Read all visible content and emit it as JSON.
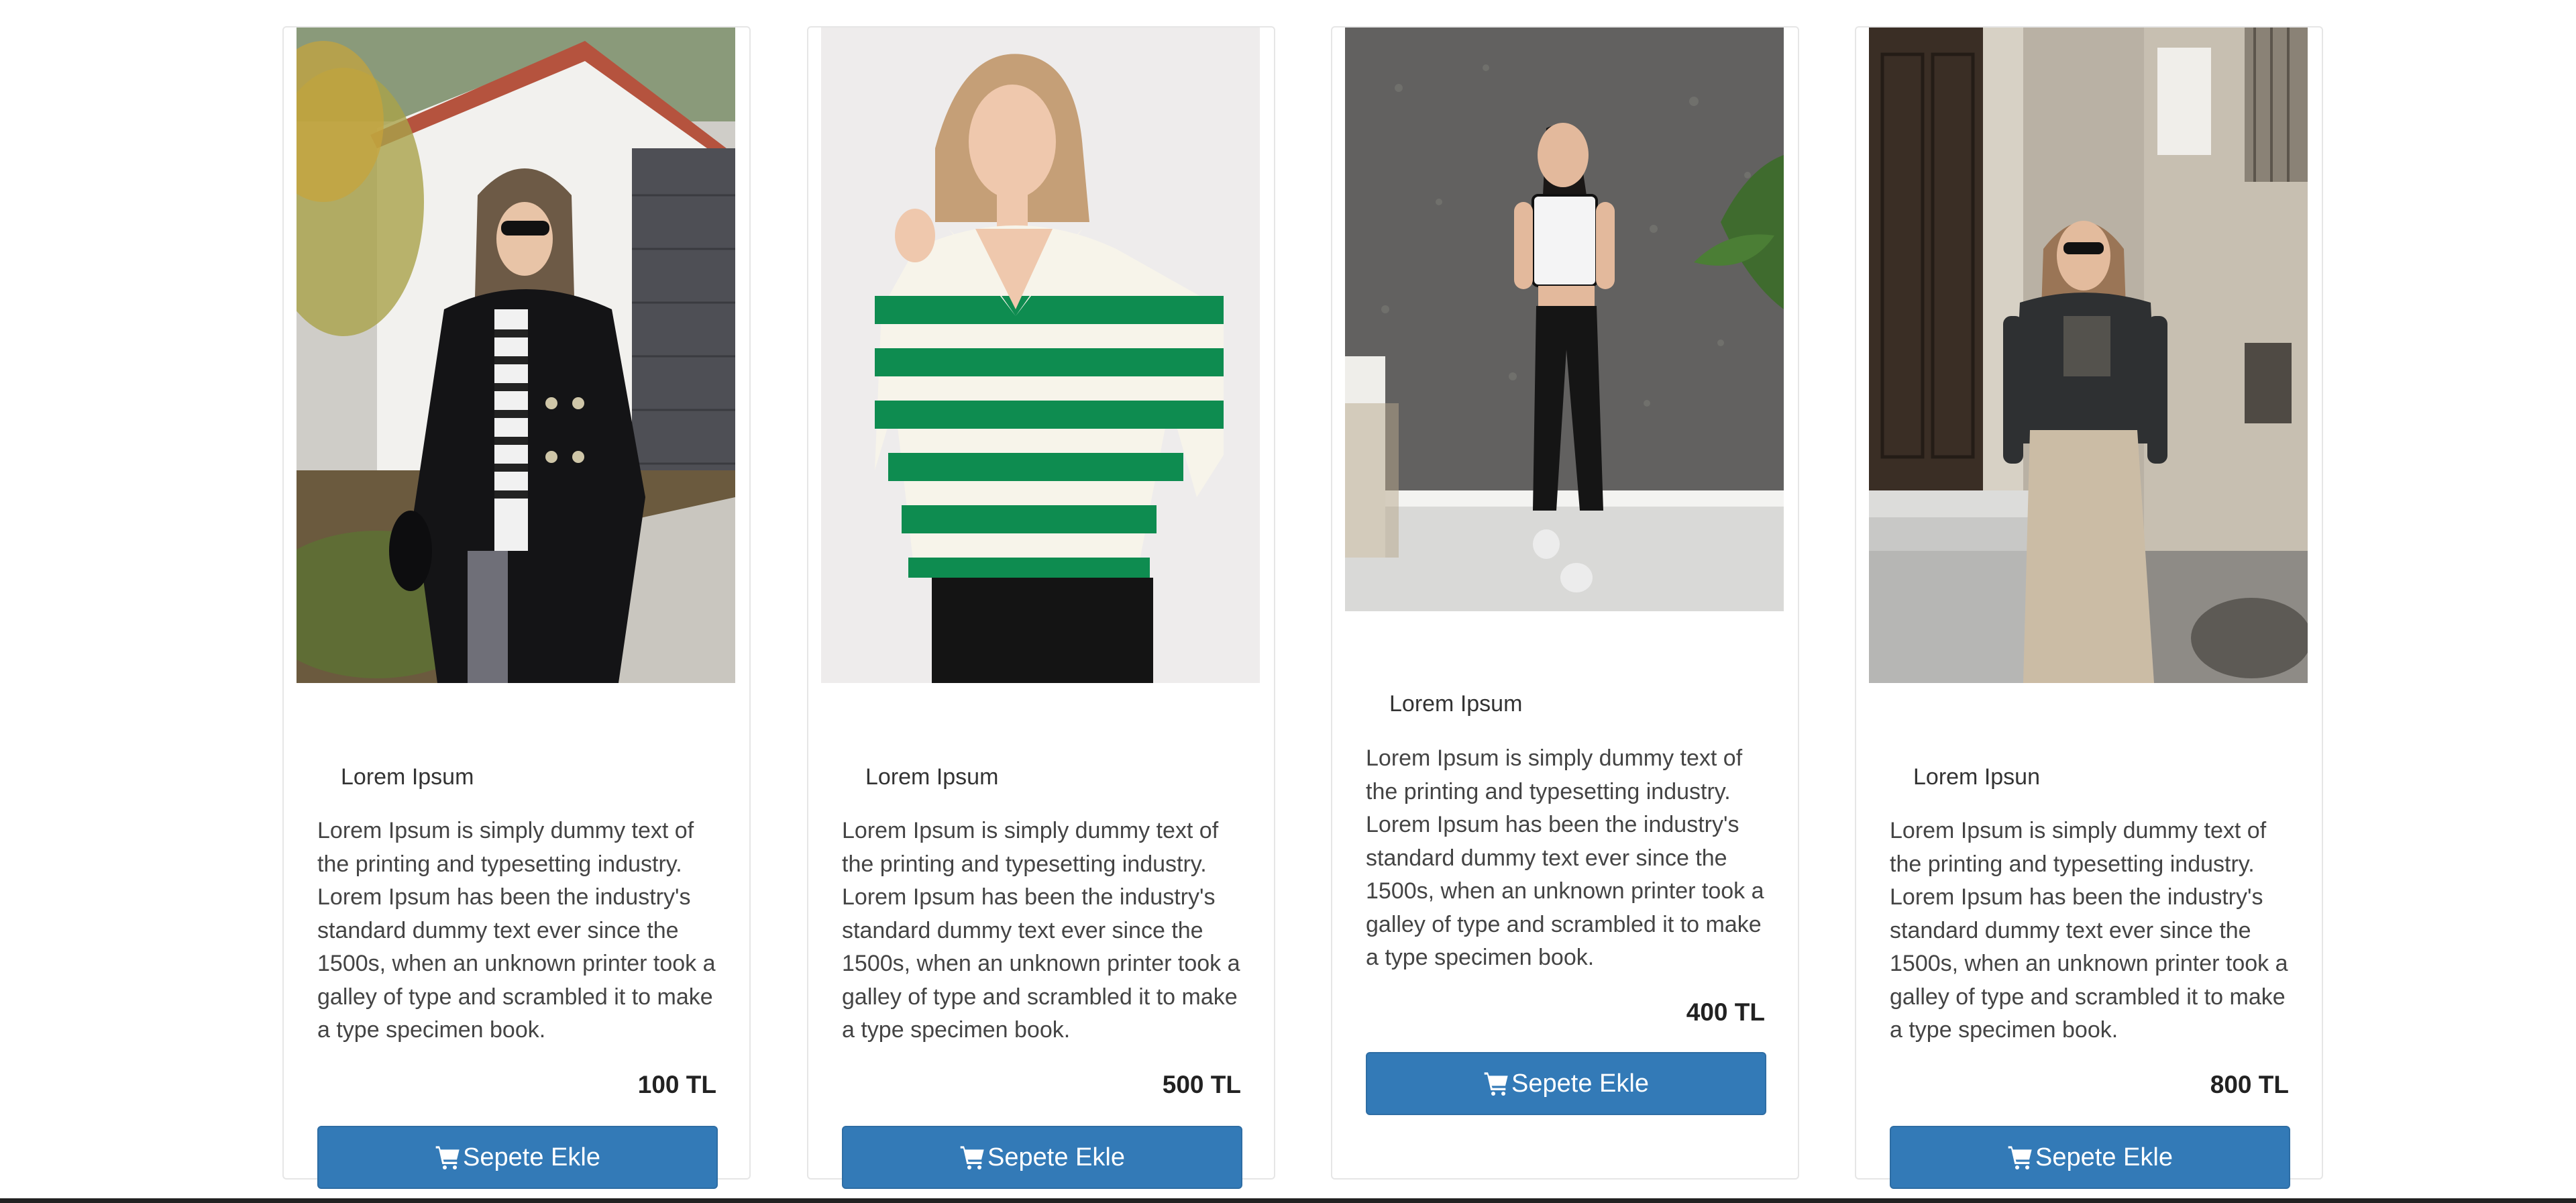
{
  "colors": {
    "accent": "#337ab7",
    "card_border": "#e6e6e6",
    "bottom_bar": "#222222"
  },
  "products": [
    {
      "name": "Lorem Ipsum",
      "description": "Lorem Ipsum is simply dummy text of the printing and typesetting industry. Lorem Ipsum has been the industry's standard dummy text ever since the 1500s, when an unknown printer took a galley of type and scrambled it to make a type specimen book.",
      "price": "100 TL",
      "button_label": "Sepete Ekle",
      "button_icon": "shopping-cart-icon",
      "image": "woman-black-coat-photo"
    },
    {
      "name": "Lorem Ipsum",
      "description": "Lorem Ipsum is simply dummy text of the printing and typesetting industry. Lorem Ipsum has been the industry's standard dummy text ever since the 1500s, when an unknown printer took a galley of type and scrambled it to make a type specimen book.",
      "price": "500 TL",
      "button_label": "Sepete Ekle",
      "button_icon": "shopping-cart-icon",
      "image": "green-striped-sweater-photo"
    },
    {
      "name": "Lorem Ipsum",
      "description": "Lorem Ipsum is simply dummy text of the printing and typesetting industry. Lorem Ipsum has been the industry's standard dummy text ever since the 1500s, when an unknown printer took a galley of type and scrambled it to make a type specimen book.",
      "price": "400 TL",
      "button_label": "Sepete Ekle",
      "button_icon": "shopping-cart-icon",
      "image": "white-crop-top-black-pants-photo"
    },
    {
      "name": "Lorem Ipsun",
      "description": "Lorem Ipsum is simply dummy text of the printing and typesetting industry. Lorem Ipsum has been the industry's standard dummy text ever since the 1500s, when an unknown printer took a galley of type and scrambled it to make a type specimen book.",
      "price": "800 TL",
      "button_label": "Sepete Ekle",
      "button_icon": "shopping-cart-icon",
      "image": "beige-cargo-skirt-photo"
    }
  ]
}
